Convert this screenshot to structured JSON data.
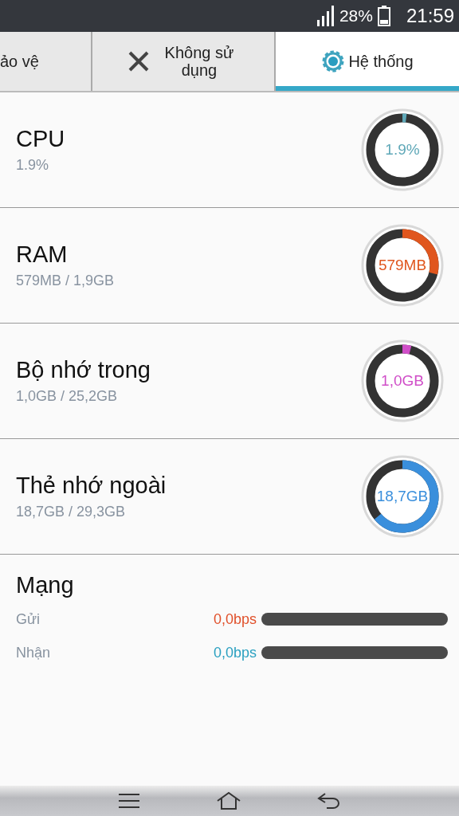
{
  "status_bar": {
    "battery": "28%",
    "time": "21:59"
  },
  "tabs": [
    {
      "label": "ảo vệ",
      "kind": "plain",
      "selected": false
    },
    {
      "label": "Không sử dụng",
      "kind": "close",
      "selected": false
    },
    {
      "label": "Hệ thống",
      "kind": "gear",
      "selected": true
    }
  ],
  "resources": [
    {
      "name": "CPU",
      "detail": "1.9%",
      "reading": "1.9%",
      "level": 0.019,
      "color": "#5fa8b8"
    },
    {
      "name": "RAM",
      "detail": "579MB / 1,9GB",
      "reading": "579MB",
      "level": 0.29,
      "color": "#e0561e"
    },
    {
      "name": "Bộ nhớ trong",
      "detail": "1,0GB / 25,2GB",
      "reading": "1,0GB",
      "level": 0.04,
      "color": "#d04ec8"
    },
    {
      "name": "Thẻ nhớ ngoài",
      "detail": "18,7GB / 29,3GB",
      "reading": "18,7GB",
      "level": 0.64,
      "color": "#3a8fdc"
    }
  ],
  "network": {
    "title": "Mạng",
    "rows": [
      {
        "label": "Gửi",
        "reading": "0,0bps",
        "level": 0,
        "color": "#e0502a"
      },
      {
        "label": "Nhận",
        "reading": "0,0bps",
        "level": 0,
        "color": "#2aa0c0"
      }
    ]
  }
}
